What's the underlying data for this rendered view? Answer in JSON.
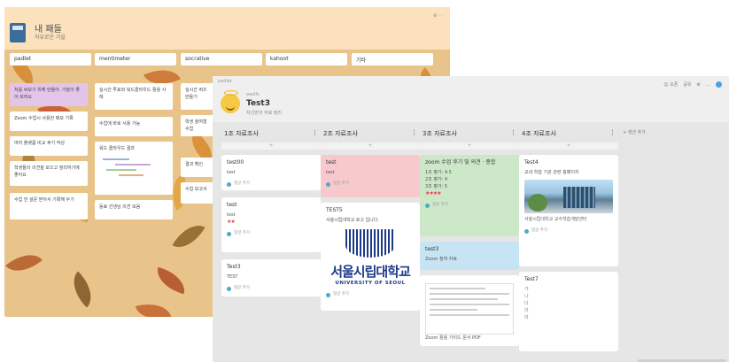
{
  "back_window": {
    "title": "내 패들",
    "subtitle": "자유로운 가을",
    "columns": [
      "padlet",
      "mentimeter",
      "socrative",
      "kahoot",
      "기타"
    ],
    "cards": [
      {
        "col": 0,
        "text": "처음 써보기 위해 만들어. 가을이 좋아 보여요",
        "style": "purple"
      },
      {
        "col": 0,
        "text": "Zoom 수업시 사용한 메모 기록",
        "style": "white"
      },
      {
        "col": 0,
        "text": "여러 플랫폼 비교 후기 작성",
        "style": "white"
      },
      {
        "col": 0,
        "text": "학생들의 의견을 모으고 정리하기에 좋아요",
        "style": "white"
      },
      {
        "col": 0,
        "text": "수업 전 설문 받아서 기록해 두기",
        "style": "white"
      },
      {
        "col": 1,
        "text": "실시간 투표와 워드클라우드 활용 사례",
        "style": "white"
      },
      {
        "col": 1,
        "text": "수업에 바로 사용 가능",
        "style": "white"
      },
      {
        "col": 1,
        "text": "워드 클라우드 결과",
        "style": "white"
      },
      {
        "col": 1,
        "text": "동료 선생님 의견 모음",
        "style": "white"
      },
      {
        "col": 2,
        "text": "실시간 퀴즈 만들기",
        "style": "white"
      },
      {
        "col": 2,
        "text": "학생 참여형 수업",
        "style": "white"
      },
      {
        "col": 2,
        "text": "결과 확인",
        "style": "white"
      },
      {
        "col": 2,
        "text": "수업 보고서",
        "style": "white"
      }
    ]
  },
  "front_window": {
    "brand": "padlet",
    "meta": "wedfs",
    "title": "Test3",
    "subtitle": "자신만의 자료 정리",
    "controls": [
      "☺ 오픈",
      "공유",
      "⚙",
      "…"
    ],
    "add_section_label": "+ 섹션 추가",
    "columns": [
      {
        "title": "1조 자료조사",
        "add": "+",
        "cards": [
          {
            "title": "test00",
            "body": "test",
            "footer": "댓글 추가",
            "style": "white"
          },
          {
            "title": "test",
            "body": "test",
            "stars": "★★",
            "footer": "댓글 추가",
            "style": "white"
          },
          {
            "title": "Test3",
            "body": "TEST",
            "footer": "댓글 추가",
            "style": "white"
          }
        ]
      },
      {
        "title": "2조 자료조사",
        "add": "+",
        "cards": [
          {
            "title": "test",
            "body": "test",
            "footer": "댓글 추가",
            "style": "pink"
          },
          {
            "title": "TEST5",
            "body": "서울시립대학교 로고 입니다.",
            "logo_kr": "서울시립대학교",
            "logo_en": "UNIVERSITY OF SEOUL",
            "footer": "댓글 추가",
            "style": "white"
          }
        ]
      },
      {
        "title": "3조 자료조사",
        "add": "+",
        "cards": [
          {
            "title": "zoom 수업 후기 및 의견 · 종합",
            "body": "1조 평가: 4.5\n2조 평가: 4\n3조 평가: 5",
            "stars": "★★★★",
            "footer": "댓글 추가",
            "style": "green"
          },
          {
            "title": "test3",
            "body": "Zoom 참여 자료",
            "footer": "",
            "style": "blue"
          },
          {
            "title": "",
            "body": "Zoom 활용 가이드 문서 PDF",
            "footer": "",
            "style": "white"
          }
        ]
      },
      {
        "title": "4조 자료조사",
        "add": "+",
        "cards": [
          {
            "title": "Test4",
            "body": "교내 학습 기관 관련 홈페이지",
            "link": "서울시립대학교 교수학습개발센터",
            "footer": "댓글 추가",
            "style": "white"
          },
          {
            "title": "Test7",
            "body": "가\n나\n다\n라\n마",
            "footer": "",
            "style": "white"
          }
        ]
      }
    ]
  }
}
